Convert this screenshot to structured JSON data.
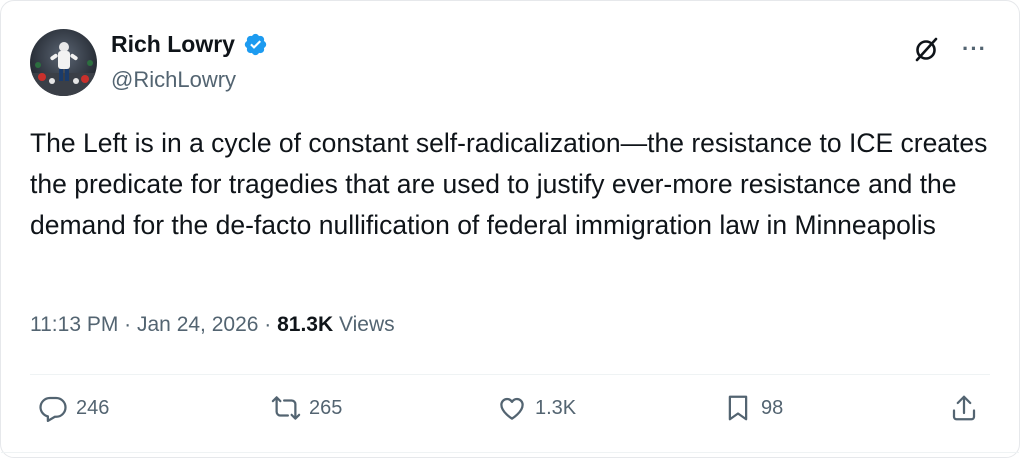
{
  "author": {
    "name": "Rich Lowry",
    "handle": "@RichLowry",
    "verified": true,
    "verified_color": "#1d9bf0"
  },
  "tweet": {
    "text": "The Left is in a cycle of constant self-radicalization—the resistance to ICE creates the predicate for tragedies that are used to justify ever-more resistance and the demand for the de-facto nullification of federal immigration law in Minneapolis",
    "time": "11:13 PM",
    "separator": " · ",
    "date": "Jan 24, 2026",
    "views_count": "81.3K",
    "views_label": " Views"
  },
  "header_icons": {
    "grok": "grok-slash-icon",
    "more": "···"
  },
  "actions": {
    "replies": {
      "icon": "reply-bubble-icon",
      "count": "246"
    },
    "reposts": {
      "icon": "repost-arrows-icon",
      "count": "265"
    },
    "likes": {
      "icon": "heart-icon",
      "count": "1.3K"
    },
    "bookmarks": {
      "icon": "bookmark-icon",
      "count": "98"
    },
    "share": {
      "icon": "share-upload-icon"
    }
  }
}
